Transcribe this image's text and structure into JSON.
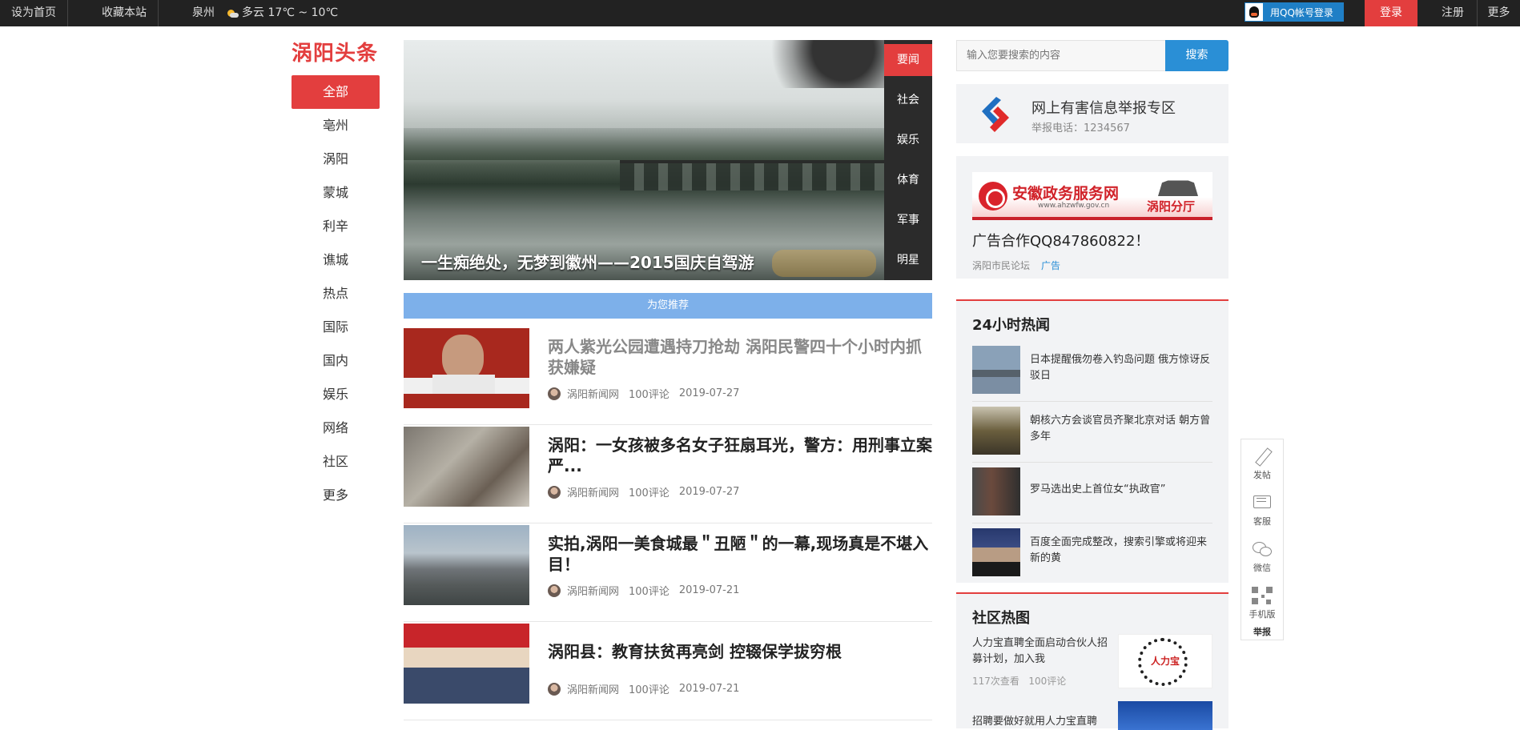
{
  "topbar": {
    "set_home": "设为首页",
    "bookmark": "收藏本站",
    "city": "泉州",
    "weather": "多云 17℃ ~ 10℃",
    "qq_login": "用QQ帐号登录",
    "login": "登录",
    "register": "注册",
    "more": "更多"
  },
  "logo": "涡阳头条",
  "leftnav": {
    "items": [
      "全部",
      "亳州",
      "涡阳",
      "蒙城",
      "利辛",
      "谯城",
      "热点",
      "国际",
      "国内",
      "娱乐",
      "网络",
      "社区",
      "更多"
    ]
  },
  "carousel": {
    "caption": "一生痴绝处，无梦到徽州——2015国庆自驾游",
    "tabs": [
      "要闻",
      "社会",
      "娱乐",
      "体育",
      "军事",
      "明星"
    ]
  },
  "recommend_bar": "为您推荐",
  "feed": [
    {
      "title": "两人紫光公园遭遇持刀抢劫 涡阳民警四十个小时内抓获嫌疑",
      "source": "涡阳新闻网",
      "comments": "100评论",
      "date": "2019-07-27"
    },
    {
      "title": "涡阳：一女孩被多名女子狂扇耳光，警方：用刑事立案严...",
      "source": "涡阳新闻网",
      "comments": "100评论",
      "date": "2019-07-27"
    },
    {
      "title": "实拍,涡阳一美食城最＂丑陋＂的一幕,现场真是不堪入目！",
      "source": "涡阳新闻网",
      "comments": "100评论",
      "date": "2019-07-21"
    },
    {
      "title": "涡阳县：教育扶贫再亮剑 控辍保学拔穷根",
      "source": "涡阳新闻网",
      "comments": "100评论",
      "date": "2019-07-21"
    }
  ],
  "search": {
    "placeholder": "输入您要搜索的内容",
    "button": "搜索"
  },
  "report": {
    "title": "网上有害信息举报专区",
    "phone": "举报电话：1234567"
  },
  "ad": {
    "banner_title": "安徽政务服务网",
    "banner_url": "www.ahzwfw.gov.cn",
    "banner_branch": "涡阳分厅",
    "title": "广告合作QQ847860822！",
    "source": "涡阳市民论坛",
    "tag": "广告"
  },
  "hot24": {
    "title": "24小时热闻",
    "items": [
      "日本提醒俄勿卷入钓岛问题 俄方惊讶反驳日",
      "朝核六方会谈官员齐聚北京对话 朝方曾多年",
      "罗马选出史上首位女“执政官”",
      "百度全面完成整改，搜索引擎或将迎来新的黄"
    ]
  },
  "community": {
    "title": "社区热图",
    "item1": {
      "text": "人力宝直聘全面启动合伙人招募计划，加入我",
      "views": "117次查看",
      "comments": "100评论",
      "thumb_text": "人力宝"
    },
    "item2": {
      "text": "招聘要做好就用人力宝直聘"
    }
  },
  "float_tools": {
    "post": "发帖",
    "service": "客服",
    "wechat": "微信",
    "mobile": "手机版",
    "report": "举报"
  }
}
